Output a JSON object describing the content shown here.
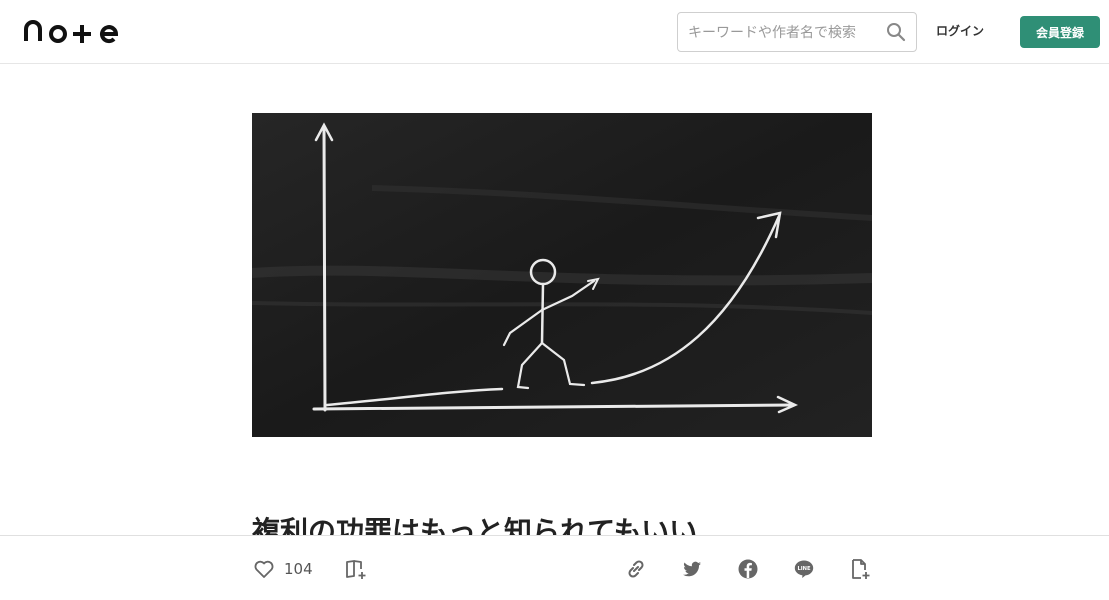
{
  "header": {
    "logo_text": "note",
    "search": {
      "placeholder": "キーワードや作者名で検索",
      "icon": "search-icon"
    },
    "login_label": "ログイン",
    "signup_label": "会員登録",
    "accent_color": "#2f8f76"
  },
  "article": {
    "hero_alt": "黒板に描かれた棒人間と上昇する曲線",
    "title": "複利の功罪はもっと知られてもいい"
  },
  "actions": {
    "like_count": "104",
    "icons": [
      "heart-icon",
      "add-to-magazine-icon",
      "link-icon",
      "twitter-icon",
      "facebook-icon",
      "line-icon",
      "embed-icon"
    ]
  }
}
